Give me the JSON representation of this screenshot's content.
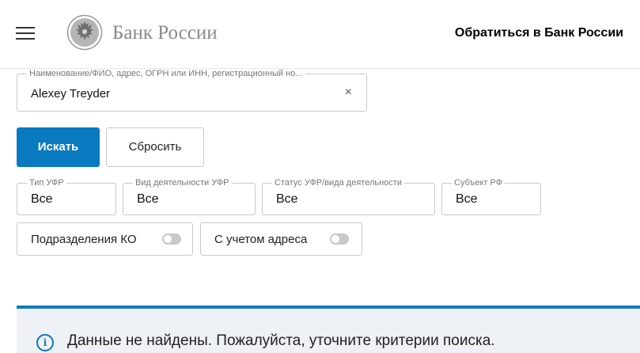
{
  "header": {
    "bank_name": "Банк России",
    "contact_link": "Обратиться в Банк России"
  },
  "search": {
    "label": "Наименование/ФИО, адрес, ОГРН или ИНН, регистрационный но...",
    "value": "Alexey Treyder",
    "clear_symbol": "×"
  },
  "buttons": {
    "search": "Искать",
    "reset": "Сбросить"
  },
  "filters": {
    "type": {
      "label": "Тип УФР",
      "value": "Все"
    },
    "activity": {
      "label": "Вид деятельности УФР",
      "value": "Все"
    },
    "status": {
      "label": "Статус УФР/вида деятельности",
      "value": "Все"
    },
    "subject": {
      "label": "Субъект РФ",
      "value": "Все"
    }
  },
  "toggles": {
    "ko": {
      "label": "Подразделения КО",
      "on": false
    },
    "address": {
      "label": "С учетом адреса",
      "on": false
    }
  },
  "notice": {
    "icon": "info-icon",
    "text": "Данные не найдены. Пожалуйста, уточните критерии поиска."
  },
  "colors": {
    "accent": "#0a7ac0",
    "notice_bg": "#eef1f5"
  }
}
